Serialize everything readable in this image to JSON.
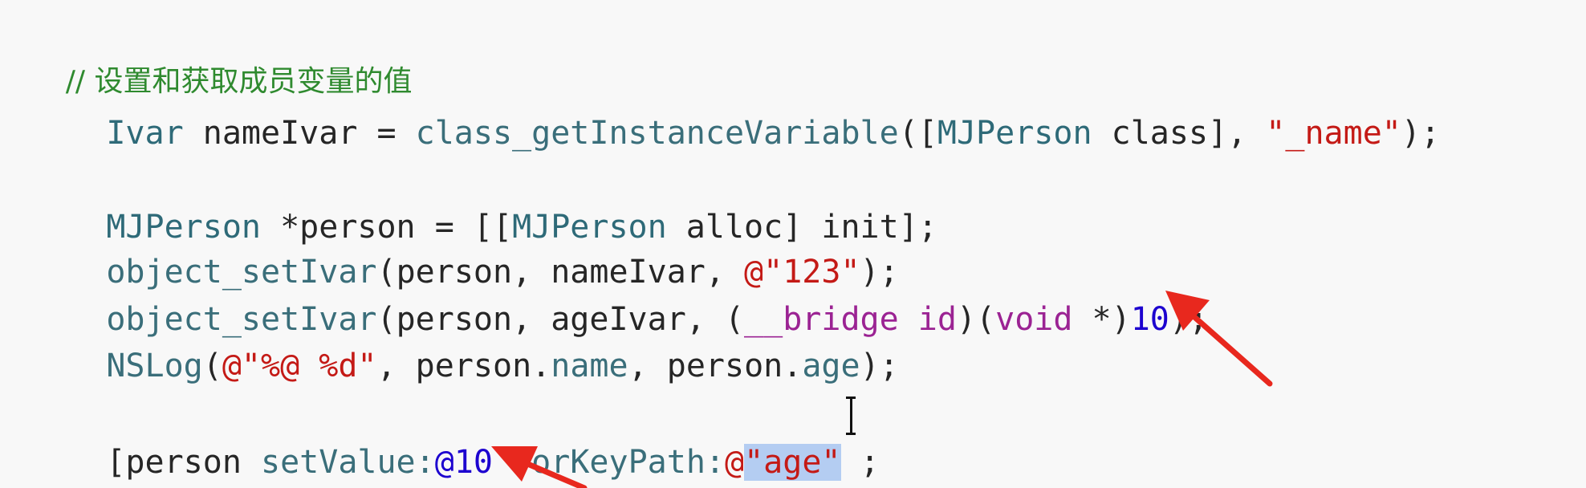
{
  "editor": {
    "lines": [
      {
        "tokens": [
          {
            "text": "// 设置和获取成员变量的值",
            "kind": "comment"
          }
        ]
      },
      {
        "tokens": [
          {
            "text": "Ivar",
            "kind": "type"
          },
          {
            "text": " nameIvar = ",
            "kind": "plain"
          },
          {
            "text": "class_getInstanceVariable",
            "kind": "function"
          },
          {
            "text": "([",
            "kind": "plain"
          },
          {
            "text": "MJPerson",
            "kind": "type"
          },
          {
            "text": " class], ",
            "kind": "plain"
          },
          {
            "text": "\"_name\"",
            "kind": "string"
          },
          {
            "text": ");",
            "kind": "plain"
          }
        ]
      },
      {
        "tokens": [
          {
            "text": "MJPerson",
            "kind": "type"
          },
          {
            "text": " *person = [[",
            "kind": "plain"
          },
          {
            "text": "MJPerson",
            "kind": "type"
          },
          {
            "text": " alloc] init];",
            "kind": "plain"
          }
        ]
      },
      {
        "tokens": [
          {
            "text": "object_setIvar",
            "kind": "function"
          },
          {
            "text": "(person, nameIvar, ",
            "kind": "plain"
          },
          {
            "text": "@\"123\"",
            "kind": "string"
          },
          {
            "text": ");",
            "kind": "plain"
          }
        ]
      },
      {
        "tokens": [
          {
            "text": "object_setIvar",
            "kind": "function"
          },
          {
            "text": "(person, ageIvar, (",
            "kind": "plain"
          },
          {
            "text": "__bridge",
            "kind": "keyword"
          },
          {
            "text": " ",
            "kind": "plain"
          },
          {
            "text": "id",
            "kind": "keyword"
          },
          {
            "text": ")(",
            "kind": "plain"
          },
          {
            "text": "void",
            "kind": "keyword"
          },
          {
            "text": " *)",
            "kind": "plain"
          },
          {
            "text": "10",
            "kind": "number"
          },
          {
            "text": ");",
            "kind": "plain"
          }
        ]
      },
      {
        "tokens": [
          {
            "text": "NSLog",
            "kind": "function"
          },
          {
            "text": "(",
            "kind": "plain"
          },
          {
            "text": "@\"%@ %d\"",
            "kind": "string"
          },
          {
            "text": ", person.",
            "kind": "plain"
          },
          {
            "text": "name",
            "kind": "property"
          },
          {
            "text": ", person.",
            "kind": "plain"
          },
          {
            "text": "age",
            "kind": "property"
          },
          {
            "text": ");",
            "kind": "plain"
          }
        ]
      },
      {
        "tokens": [
          {
            "text": "[person ",
            "kind": "plain"
          },
          {
            "text": "setValue:",
            "kind": "method"
          },
          {
            "text": "@10",
            "kind": "number"
          },
          {
            "text": " ",
            "kind": "plain"
          },
          {
            "text": "forKeyPath:",
            "kind": "method"
          },
          {
            "text": "@",
            "kind": "string"
          },
          {
            "text": "\"age\"",
            "kind": "string-selected"
          },
          {
            "text": " ",
            "kind": "plain"
          },
          {
            "text": ";",
            "kind": "plain"
          }
        ]
      }
    ]
  },
  "colors": {
    "background": "#f8f8f8",
    "comment": "#2f8a2f",
    "type": "#2e6a78",
    "string": "#c41a16",
    "keyword": "#9b2393",
    "number": "#1c00cf",
    "selection": "#b4cdf2",
    "annotation_arrow": "#e8281e"
  },
  "icons": {
    "cursor": "i-beam-cursor-icon",
    "arrows": [
      "red-arrow-icon",
      "red-arrow-icon"
    ]
  }
}
